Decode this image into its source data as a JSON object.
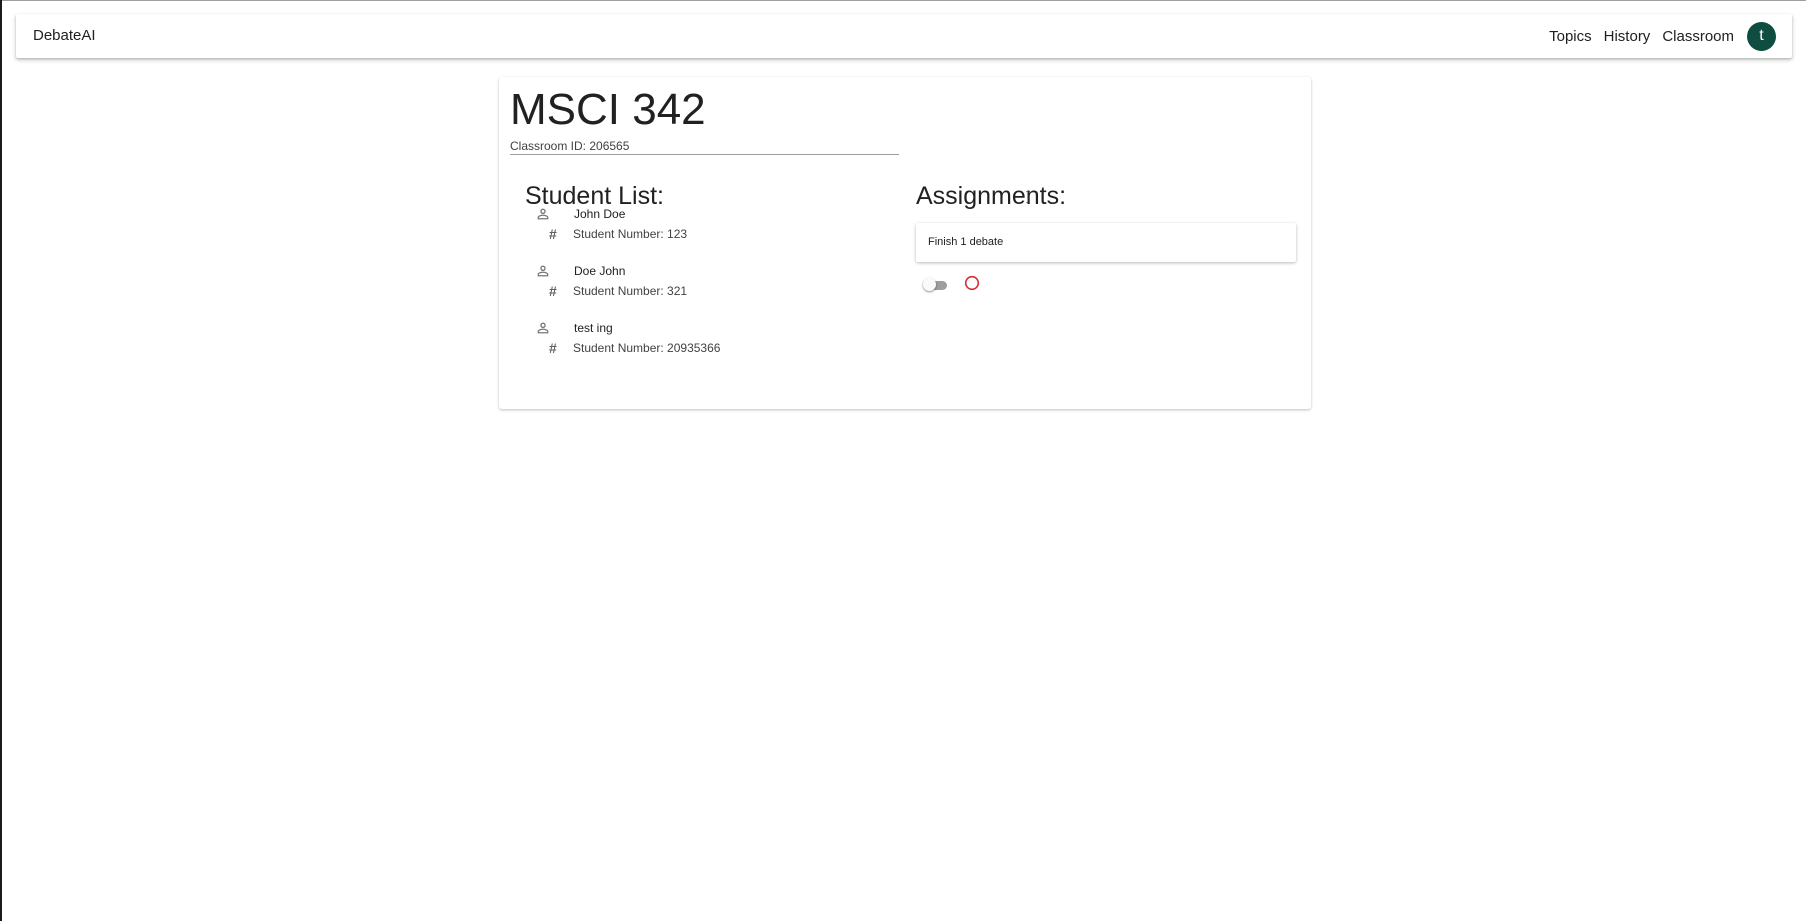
{
  "app": {
    "brand": "DebateAI",
    "nav": [
      "Topics",
      "History",
      "Classroom"
    ],
    "avatar_initial": "t",
    "avatar_color": "#0e4d3f"
  },
  "classroom": {
    "title": "MSCI 342",
    "id_text": "Classroom ID: 206565"
  },
  "students": {
    "heading": "Student List:",
    "items": [
      {
        "name": "John Doe",
        "number_text": "Student Number: 123"
      },
      {
        "name": "Doe John",
        "number_text": "Student Number: 321"
      },
      {
        "name": "test ing",
        "number_text": "Student Number: 20935366"
      }
    ]
  },
  "assignments": {
    "heading": "Assignments:",
    "items": [
      {
        "title": "Finish 1 debate"
      }
    ],
    "toggle_on": false,
    "delete_icon": "circle-outline-icon",
    "delete_color": "#d32f2f"
  },
  "icons": {
    "student": "person-outline-icon",
    "student_number": "hash-icon"
  }
}
